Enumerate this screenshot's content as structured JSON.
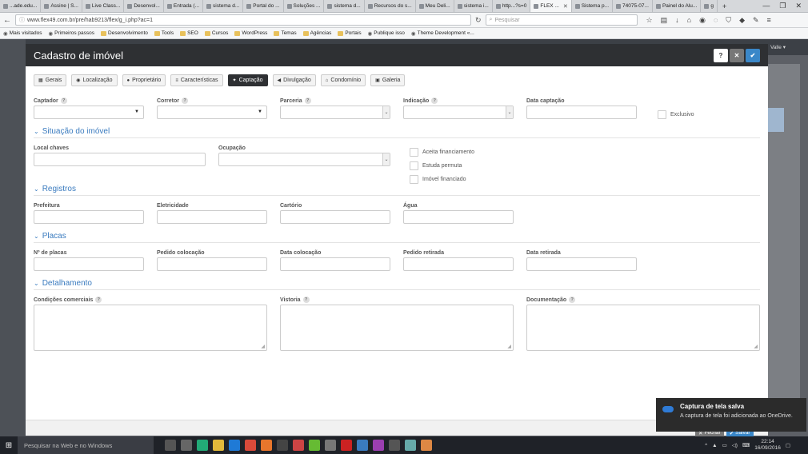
{
  "browser": {
    "tabs": [
      {
        "label": "...ade.edu..."
      },
      {
        "label": "Assine | S..."
      },
      {
        "label": "Live Class..."
      },
      {
        "label": "Desenvol..."
      },
      {
        "label": "Entrada (..."
      },
      {
        "label": "sistema d..."
      },
      {
        "label": "Portal do ..."
      },
      {
        "label": "Soluções ..."
      },
      {
        "label": "sistema d..."
      },
      {
        "label": "Recursos do s..."
      },
      {
        "label": "Meu Deli..."
      },
      {
        "label": "sistema i..."
      },
      {
        "label": "http...?s=0"
      },
      {
        "label": "FLEX ...",
        "active": true
      },
      {
        "label": "Sistema p..."
      },
      {
        "label": "74075-07..."
      },
      {
        "label": "Painel do Alu..."
      },
      {
        "label": "g"
      }
    ],
    "url": "www.flex49.com.br/pre/hab9213/flex/g_i.php?ac=1",
    "search_placeholder": "Pesquisar",
    "bookmarks": [
      {
        "label": "Mais visitados",
        "icon": "gear-icon"
      },
      {
        "label": "Primeiros passos",
        "icon": "firefox-icon"
      },
      {
        "label": "Desenvolvimento",
        "icon": "folder-icon"
      },
      {
        "label": "Tools",
        "icon": "folder-icon"
      },
      {
        "label": "SEO",
        "icon": "folder-icon"
      },
      {
        "label": "Cursos",
        "icon": "folder-icon"
      },
      {
        "label": "WordPress",
        "icon": "folder-icon"
      },
      {
        "label": "Temas",
        "icon": "folder-icon"
      },
      {
        "label": "Agências",
        "icon": "folder-icon"
      },
      {
        "label": "Portais",
        "icon": "folder-icon"
      },
      {
        "label": "Publique isso",
        "icon": "bookmark-icon"
      },
      {
        "label": "Theme Development «...",
        "icon": "wordpress-icon"
      }
    ]
  },
  "background": {
    "user_label": "Valle ▾"
  },
  "modal": {
    "title": "Cadastro de imóvel",
    "help_label": "?",
    "close_label": "✕",
    "confirm_label": "✔",
    "tabs": [
      {
        "label": "Gerais",
        "icon": "grid-icon"
      },
      {
        "label": "Localização",
        "icon": "pin-icon"
      },
      {
        "label": "Proprietário",
        "icon": "user-icon"
      },
      {
        "label": "Características",
        "icon": "list-icon"
      },
      {
        "label": "Captação",
        "icon": "pushpin-icon",
        "active": true
      },
      {
        "label": "Divulgação",
        "icon": "megaphone-icon"
      },
      {
        "label": "Condomínio",
        "icon": "home-icon"
      },
      {
        "label": "Galeria",
        "icon": "image-icon"
      }
    ],
    "captacao": {
      "captador_label": "Captador",
      "corretor_label": "Corretor",
      "parceria_label": "Parceria",
      "indicacao_label": "Indicação",
      "data_captacao_label": "Data captação",
      "exclusivo_label": "Exclusivo"
    },
    "situacao": {
      "title": "Situação do imóvel",
      "local_chaves_label": "Local chaves",
      "ocupacao_label": "Ocupação",
      "aceita_financiamento_label": "Aceita financiamento",
      "estuda_permuta_label": "Estuda permuta",
      "imovel_financiado_label": "Imóvel financiado"
    },
    "registros": {
      "title": "Registros",
      "prefeitura_label": "Prefeitura",
      "eletricidade_label": "Eletricidade",
      "cartorio_label": "Cartório",
      "agua_label": "Água"
    },
    "placas": {
      "title": "Placas",
      "n_placas_label": "Nº de placas",
      "pedido_colocacao_label": "Pedido colocação",
      "data_colocacao_label": "Data colocação",
      "pedido_retirada_label": "Pedido retirada",
      "data_retirada_label": "Data retirada"
    },
    "detalhamento": {
      "title": "Detalhamento",
      "condicoes_label": "Condições comerciais",
      "vistoria_label": "Vistoria",
      "documentacao_label": "Documentação"
    },
    "footer": {
      "fechar_label": "Fechar",
      "salvar_label": "Salvar"
    }
  },
  "toast": {
    "title": "Captura de tela salva",
    "body": "A captura de tela foi adicionada ao OneDrive."
  },
  "taskbar": {
    "search_placeholder": "Pesquisar na Web e no Windows",
    "time": "22:14",
    "date": "16/09/2016"
  }
}
